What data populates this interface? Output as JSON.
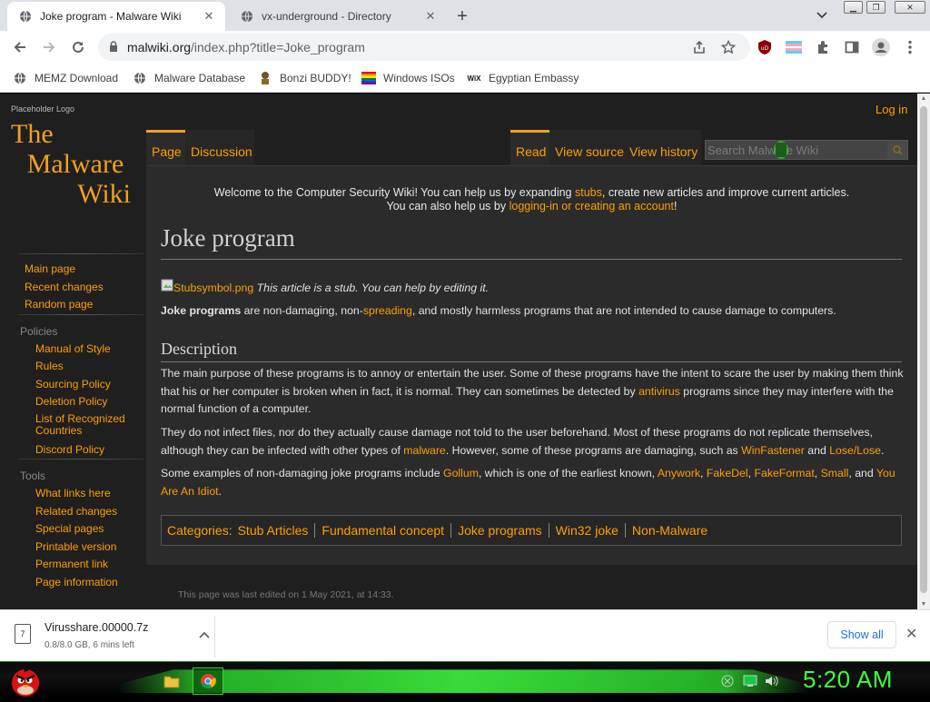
{
  "browser": {
    "tabs": [
      {
        "title": "Joke program - Malware Wiki",
        "active": true
      },
      {
        "title": "vx-underground - Directory",
        "active": false
      }
    ],
    "new_tab_symbol": "+",
    "url": {
      "host": "malwiki.org",
      "path": "/index.php?title=Joke_program"
    },
    "bookmarks": [
      {
        "label": "MEMZ Download",
        "icon": "globe-icon"
      },
      {
        "label": "Malware Database",
        "icon": "globe-icon"
      },
      {
        "label": "Bonzi BUDDY!",
        "icon": "bonzi-icon"
      },
      {
        "label": "Windows ISOs",
        "icon": "windows-flag-icon"
      },
      {
        "label": "Egyptian Embassy",
        "icon": "wix-icon"
      }
    ]
  },
  "wiki": {
    "placeholder_logo": "Placeholder Logo",
    "name_lines": [
      "The",
      "Malware",
      "Wiki"
    ],
    "login": "Log in",
    "nav": {
      "main": [
        "Main page",
        "Recent changes",
        "Random page"
      ],
      "policies_heading": "Policies",
      "policies": [
        "Manual of Style",
        "Rules",
        "Sourcing Policy",
        "Deletion Policy",
        "List of Recognized Countries",
        "Discord Policy"
      ],
      "tools_heading": "Tools",
      "tools": [
        "What links here",
        "Related changes",
        "Special pages",
        "Printable version",
        "Permanent link",
        "Page information"
      ]
    },
    "tabs": {
      "page": "Page",
      "discussion": "Discussion",
      "read": "Read",
      "view_source": "View source",
      "view_history": "View history"
    },
    "search_placeholder": "Search Malware Wiki",
    "sitenotice": {
      "line1_a": "Welcome to the Computer Security Wiki! You can help us by expanding ",
      "line1_link": "stubs",
      "line1_b": ", create new articles and improve current articles.",
      "line2_a": "You can also help us by ",
      "line2_link": "logging-in or creating an account",
      "line2_b": "!"
    },
    "title": "Joke program",
    "stub": {
      "image_alt": "Stubsymbol.png",
      "text": "This article is a stub. You can help by editing it."
    },
    "intro": {
      "bold": "Joke programs",
      "a": " are non-damaging, non-",
      "link": "spreading",
      "b": ", and mostly harmless programs that are not intended to cause damage to computers."
    },
    "section_title": "Description",
    "p1": {
      "a": "The main purpose of these programs is to annoy or entertain the user. Some of these programs have the intent to scare the user by making them think that his or her computer is broken when in fact, it is normal. They can sometimes be detected by ",
      "link": "antivirus",
      "b": " programs since they may interfere with the normal function of a computer."
    },
    "p2": {
      "a": "They do not infect files, nor do they actually cause damage not told to the user beforehand. Most of these programs do not replicate themselves, although they can be infected with other types of ",
      "link1": "malware",
      "b": ". However, some of these programs are damaging, such as ",
      "link2": "WinFastener",
      "c": " and ",
      "link3": "Lose/Lose",
      "d": "."
    },
    "p3": {
      "a": "Some examples of non-damaging joke programs include ",
      "link1": "Gollum",
      "b": ", which is one of the earliest known, ",
      "link2": "Anywork",
      "c": ", ",
      "link3": "FakeDel",
      "d": ", ",
      "link4": "FakeFormat",
      "e": ", ",
      "link5": "Small",
      "f": ", and ",
      "link6": "You Are An Idiot",
      "g": "."
    },
    "categories_label": "Categories",
    "categories": [
      "Stub Articles",
      "Fundamental concept",
      "Joke programs",
      "Win32 joke",
      "Non-Malware"
    ],
    "footer": "This page was last edited on 1 May 2021, at 14:33."
  },
  "download": {
    "filename": "Virusshare.00000.7z",
    "status": "0.8/8.0 GB, 6 mins left",
    "show_all": "Show all"
  },
  "taskbar": {
    "clock": "5:20 AM"
  },
  "colors": {
    "accent": "#f0a020",
    "page_bg": "#2b2b2b",
    "clock": "#3cff3c"
  }
}
